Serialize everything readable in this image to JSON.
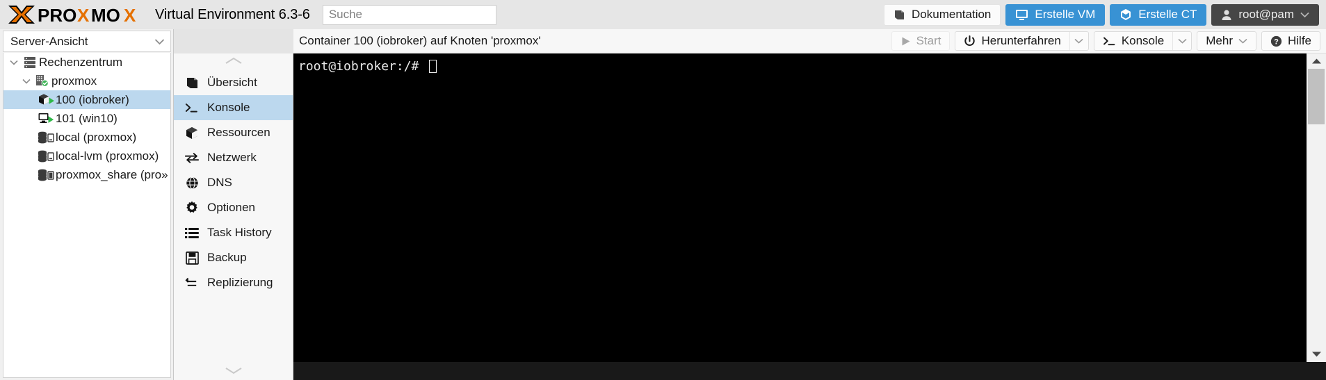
{
  "header": {
    "brand_text": "PROXMOX",
    "product_name": "Virtual Environment 6.3-6",
    "search_placeholder": "Suche",
    "search_value": "",
    "buttons": {
      "documentation": "Dokumentation",
      "create_vm": "Erstelle VM",
      "create_ct": "Erstelle CT",
      "user": "root@pam"
    },
    "colors": {
      "accent_blue": "#3892d4",
      "user_dark": "#464646",
      "bar_bg": "#e6e6e6"
    }
  },
  "sidebar": {
    "view_selector": "Server-Ansicht",
    "tree": [
      {
        "label": "Rechenzentrum",
        "depth": 0,
        "icon": "datacenter-icon",
        "expander": "chevron-down",
        "selected": false
      },
      {
        "label": "proxmox",
        "depth": 1,
        "icon": "node-icon",
        "expander": "chevron-down",
        "selected": false
      },
      {
        "label": "100 (iobroker)",
        "depth": 2,
        "icon": "container-running-icon",
        "expander": "",
        "selected": true
      },
      {
        "label": "101 (win10)",
        "depth": 2,
        "icon": "vm-running-icon",
        "expander": "",
        "selected": false
      },
      {
        "label": "local (proxmox)",
        "depth": 2,
        "icon": "storage-icon",
        "expander": "",
        "selected": false
      },
      {
        "label": "local-lvm (proxmox)",
        "depth": 2,
        "icon": "storage-icon",
        "expander": "",
        "selected": false
      },
      {
        "label": "proxmox_share (pro»",
        "depth": 2,
        "icon": "storage-icon",
        "expander": "",
        "selected": false
      }
    ]
  },
  "menu": {
    "scroll_up": "chevron-up-icon",
    "scroll_down": "chevron-down-icon",
    "items": [
      {
        "label": "Übersicht",
        "icon": "book-icon",
        "selected": false
      },
      {
        "label": "Konsole",
        "icon": "terminal-icon",
        "selected": true
      },
      {
        "label": "Ressourcen",
        "icon": "cube-icon",
        "selected": false
      },
      {
        "label": "Netzwerk",
        "icon": "network-icon",
        "selected": false
      },
      {
        "label": "DNS",
        "icon": "globe-icon",
        "selected": false
      },
      {
        "label": "Optionen",
        "icon": "gear-icon",
        "selected": false
      },
      {
        "label": "Task History",
        "icon": "list-icon",
        "selected": false
      },
      {
        "label": "Backup",
        "icon": "floppy-icon",
        "selected": false
      },
      {
        "label": "Replizierung",
        "icon": "replication-icon",
        "selected": false
      }
    ]
  },
  "content": {
    "title": "Container 100 (iobroker) auf Knoten 'proxmox'",
    "toolbar": {
      "start": "Start",
      "shutdown": "Herunterfahren",
      "console": "Konsole",
      "more": "Mehr",
      "help": "Hilfe"
    }
  },
  "terminal": {
    "prompt": "root@iobroker:/# ",
    "cursor": "block",
    "bg": "#000000",
    "fg": "#e8e8e8"
  }
}
